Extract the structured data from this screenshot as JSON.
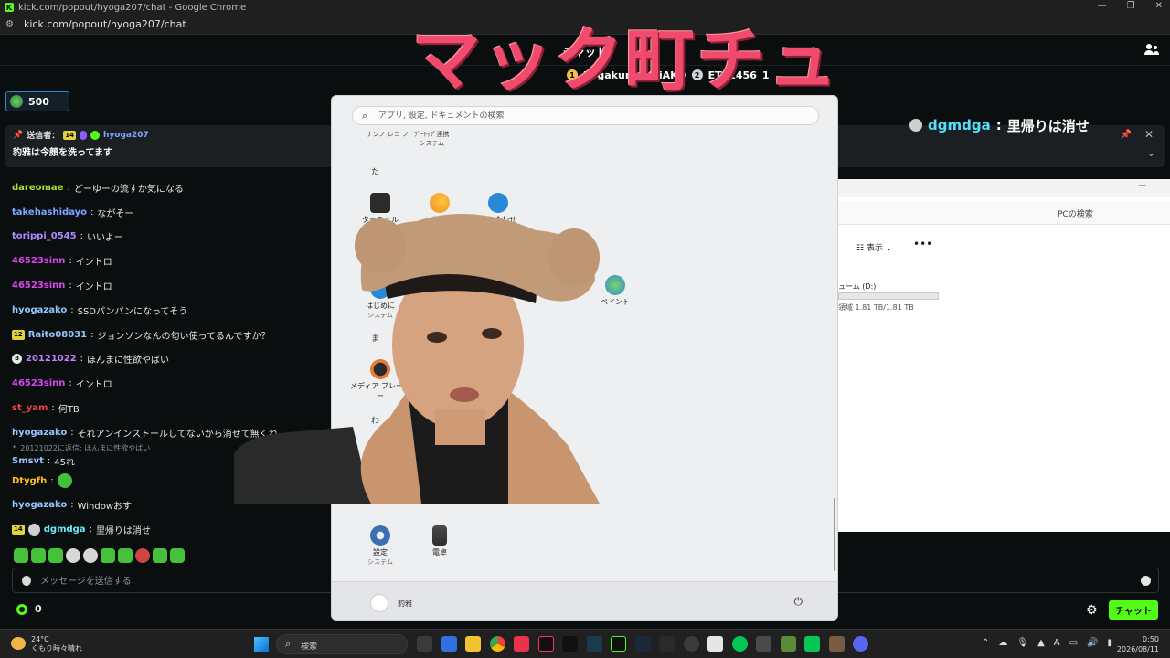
{
  "browser": {
    "window_title": "kick.com/popout/hyoga207/chat - Google Chrome",
    "url": "kick.com/popout/hyoga207/chat",
    "favicon": "K"
  },
  "header": {
    "title": "チャット",
    "pinned_names": [
      "hogakunishikiAKO",
      "ETA1456"
    ],
    "ranks": [
      "1",
      "2"
    ],
    "suffix": "1"
  },
  "gift_chip": {
    "count": "500"
  },
  "pinned": {
    "sender_label": "送信者：",
    "sub_months": "14",
    "sender": "hyoga207",
    "message": "豹雅は今顔を洗ってます"
  },
  "messages": [
    {
      "user": "dareomae",
      "color": "#a3e635",
      "text": "どーゆーの流すか気になる"
    },
    {
      "user": "takehashidayo",
      "color": "#7aa7ff",
      "text": "ながそー"
    },
    {
      "user": "torippi_0545",
      "color": "#a78bfa",
      "text": "いいよー"
    },
    {
      "user": "46523sinn",
      "color": "#d946ef",
      "text": "イントロ"
    },
    {
      "user": "46523sinn",
      "color": "#d946ef",
      "text": "イントロ"
    },
    {
      "user": "hyogazako",
      "color": "#93c5fd",
      "text": "SSDパンパンになってそう"
    },
    {
      "user": "Raito08031",
      "color": "#93c5fd",
      "text": "ジョンソンなんの匂い使ってるんですか？",
      "badge": "12"
    },
    {
      "user": "20121022",
      "color": "#c084fc",
      "text": "ほんまに性欲やばい",
      "badge": "8"
    },
    {
      "user": "46523sinn",
      "color": "#d946ef",
      "text": "イントロ"
    },
    {
      "user": "st_yam",
      "color": "#ef4444",
      "text": "何TB"
    },
    {
      "user": "hyogazako",
      "color": "#93c5fd",
      "text": "それアンインストールしてないから消せて無くね"
    },
    {
      "user": "Smsvt",
      "color": "#93c5fd",
      "text": "45れ",
      "reply": "20121022に返信: ほんまに性欲やばい"
    },
    {
      "user": "Dtygfh",
      "color": "#fbbf24",
      "text": ""
    },
    {
      "user": "hyogazako",
      "color": "#93c5fd",
      "text": "Windowおす"
    },
    {
      "user": "dgmdga",
      "color": "#67e8f9",
      "text": "里帰りは消せ",
      "badge": "14"
    }
  ],
  "input": {
    "placeholder": "メッセージを送信する"
  },
  "footer": {
    "points": "0",
    "chat_button": "チャット"
  },
  "overlay": {
    "title": "マック町チュ",
    "chat_user": "dgmdga",
    "chat_sep": " : ",
    "chat_text": "里帰りは消せ"
  },
  "explorer": {
    "search_label": "PCの検索",
    "view_label": "表示",
    "drive_label": "ューム (D:)",
    "free_label": "領域 1.81 TB/1.81 TB"
  },
  "startmenu": {
    "search_placeholder": "アプリ, 設定, ドキュメントの検索",
    "cut_label_1": "ナンノ レコ ノ",
    "cut_label_2": "ﾌﾞｰﾄｯﾌﾟ連携",
    "cut_sub": "システム",
    "letters": [
      "た",
      "ま",
      "わ"
    ],
    "apps": [
      {
        "name": "ターミナル",
        "sub": ""
      },
      {
        "name": "天気",
        "sub": ""
      },
      {
        "name": "問い合わせ",
        "sub": ""
      },
      {
        "name": "はじめに",
        "sub": "システム"
      },
      {
        "name": "ペイント",
        "sub": ""
      },
      {
        "name": "メディア プレーヤー",
        "sub": ""
      },
      {
        "name": "設定",
        "sub": "システム"
      },
      {
        "name": "電卓",
        "sub": ""
      }
    ],
    "user": "豹雅"
  },
  "taskbar": {
    "temp": "24°C",
    "weather": "くもり時々晴れ",
    "search": "検索",
    "time": "0:50",
    "date": "2026/08/11"
  }
}
